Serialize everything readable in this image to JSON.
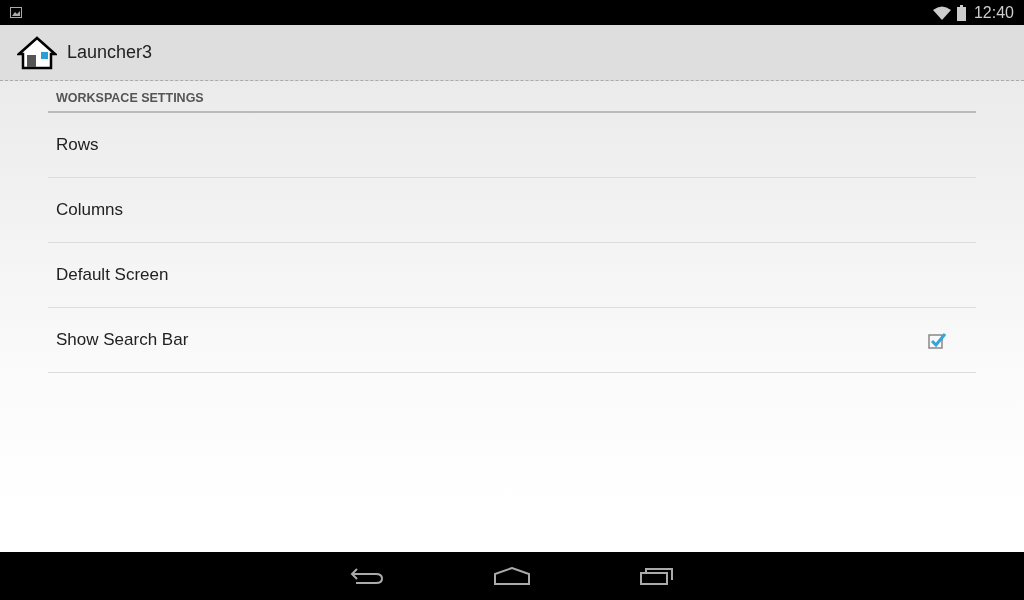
{
  "status_bar": {
    "time": "12:40"
  },
  "action_bar": {
    "title": "Launcher3"
  },
  "section": {
    "title": "WORKSPACE SETTINGS"
  },
  "items": [
    {
      "label": "Rows",
      "kind": "plain"
    },
    {
      "label": "Columns",
      "kind": "plain"
    },
    {
      "label": "Default Screen",
      "kind": "plain"
    },
    {
      "label": "Show Search Bar",
      "kind": "checkbox",
      "checked": true
    }
  ]
}
